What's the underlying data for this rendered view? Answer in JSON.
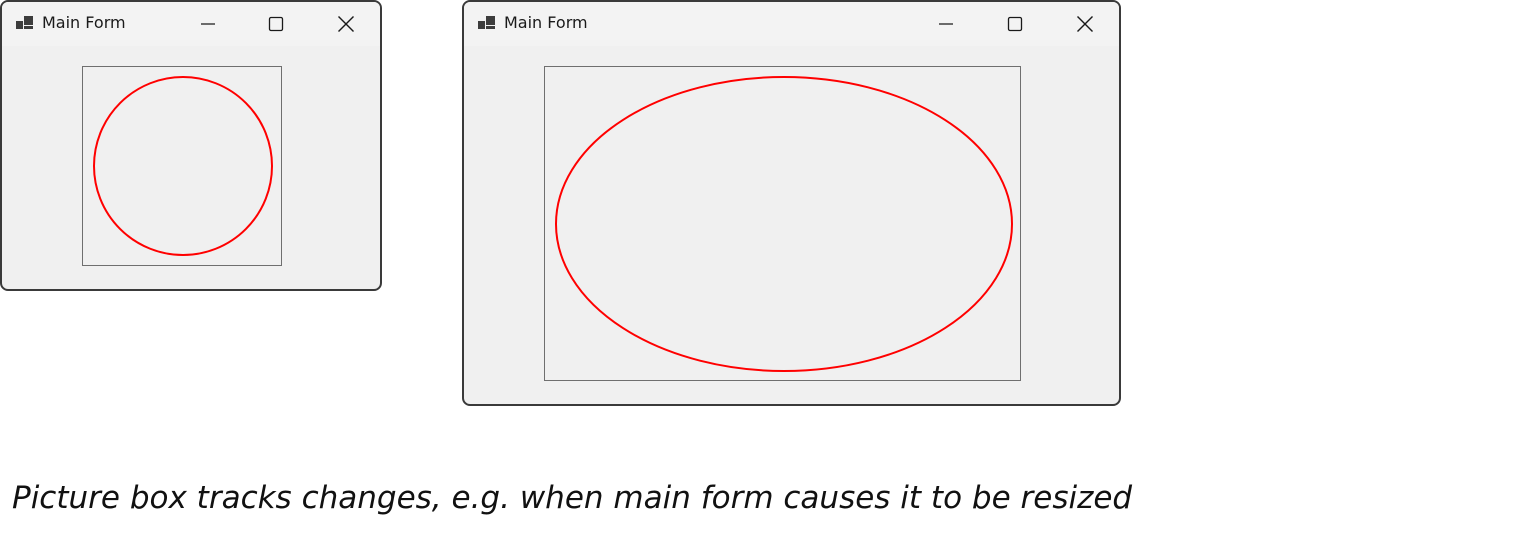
{
  "windows": [
    {
      "title": "Main Form",
      "icon": "app-window-icon",
      "controls": [
        "minimize-icon",
        "maximize-icon",
        "close-icon"
      ]
    },
    {
      "title": "Main Form",
      "icon": "app-window-icon",
      "controls": [
        "minimize-icon",
        "maximize-icon",
        "close-icon"
      ]
    }
  ],
  "caption": "Picture box tracks changes, e.g. when main form causes it to be resized",
  "colors": {
    "ellipse_stroke": "#ff0000",
    "window_background": "#f0f0f0",
    "picturebox_border": "#6f6f6f"
  }
}
